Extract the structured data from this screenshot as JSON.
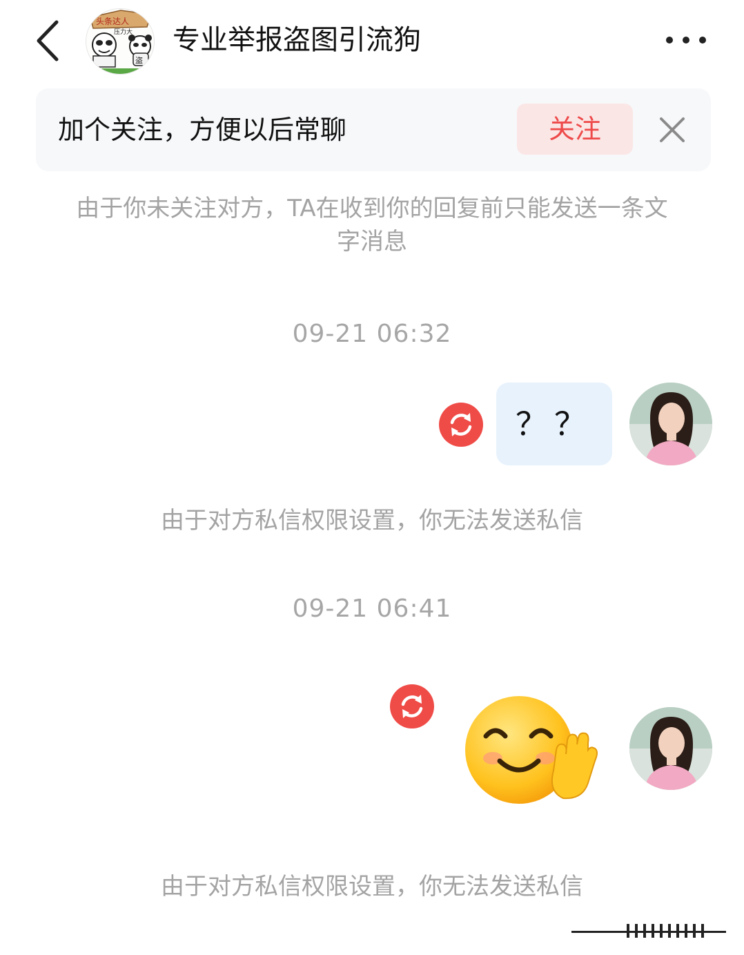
{
  "header": {
    "title": "专业举报盗图引流狗",
    "avatar_badge_top": "头条达人",
    "avatar_badge_sub": "压力大",
    "avatar_badge_char": "盗"
  },
  "follow_banner": {
    "text": "加个关注，方便以后常聊",
    "button_label": "关注"
  },
  "notices": {
    "follow_limit": "由于你未关注对方，TA在收到你的回复前只能发送一条文字消息",
    "permission_1": "由于对方私信权限设置，你无法发送私信",
    "permission_2": "由于对方私信权限设置，你无法发送私信"
  },
  "messages": [
    {
      "timestamp": "09-21 06:32",
      "type": "text",
      "content": "？？",
      "status": "failed"
    },
    {
      "timestamp": "09-21 06:41",
      "type": "sticker",
      "content": "smiling-waving-emoji",
      "status": "failed"
    }
  ],
  "colors": {
    "accent": "#ee4a4a",
    "bubble": "#e7f2fd",
    "banner_bg": "#f7f8fa",
    "muted_text": "#a3a3a3"
  }
}
